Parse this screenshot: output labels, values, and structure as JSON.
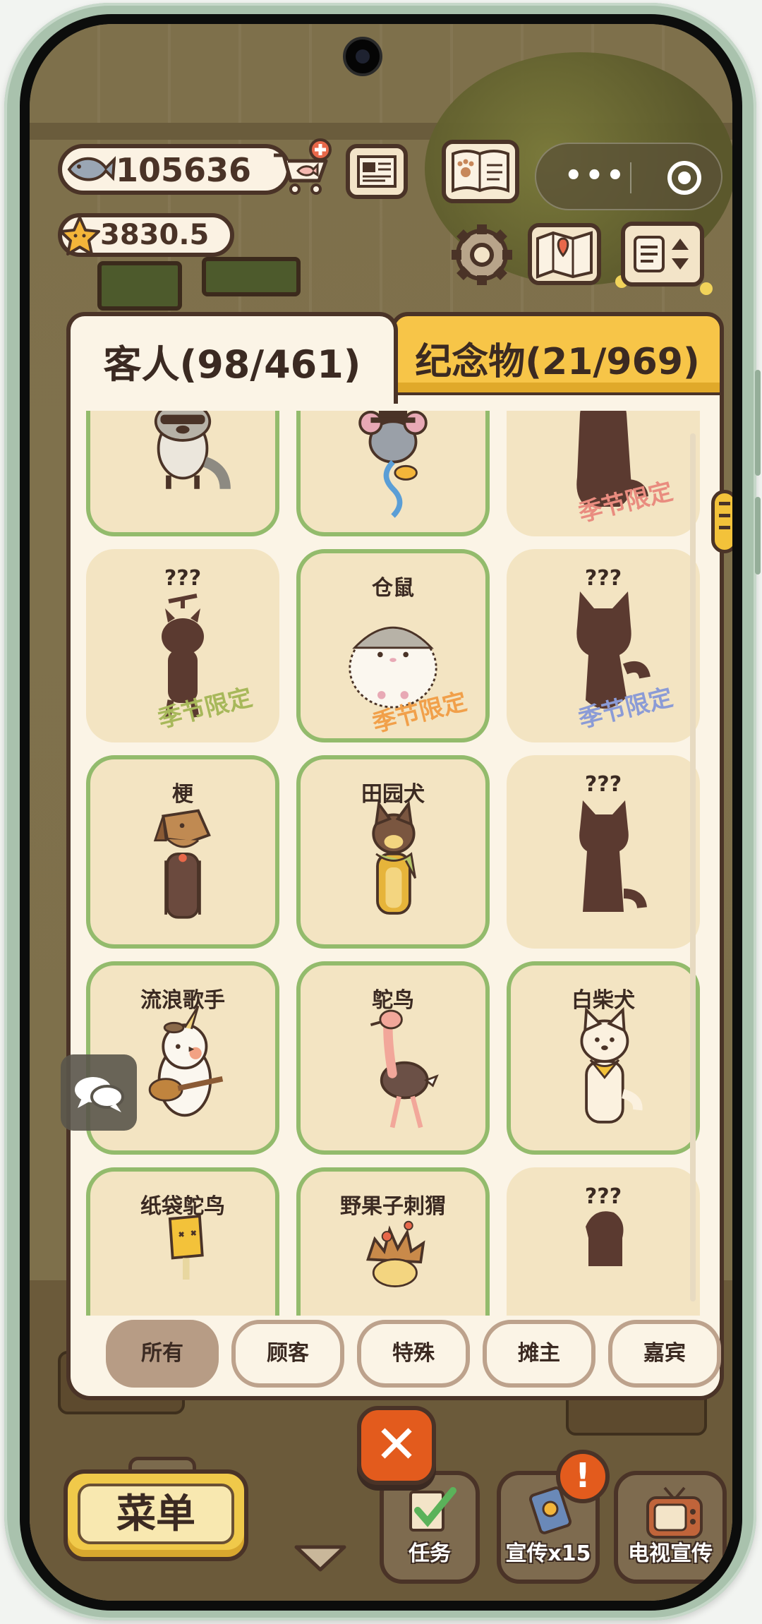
{
  "hud": {
    "fish_count": "105636",
    "star_count": "3830.5"
  },
  "tabs": [
    {
      "label": "客人(98/461)",
      "active": true
    },
    {
      "label": "纪念物(21/969)",
      "active": false
    }
  ],
  "limited_label": "季节限定",
  "guests": [
    {
      "name": "",
      "owned": true,
      "limited": false,
      "silhouette": false,
      "figure": "raccoon"
    },
    {
      "name": "",
      "owned": true,
      "limited": false,
      "silhouette": false,
      "figure": "mouse-hat"
    },
    {
      "name": "",
      "owned": false,
      "limited": true,
      "limited_color": "#e98c7f",
      "silhouette": true,
      "figure": "silhouette-fluffy"
    },
    {
      "name": "???",
      "owned": false,
      "limited": true,
      "limited_color": "#a7b85a",
      "silhouette": true,
      "figure": "silhouette-propeller"
    },
    {
      "name": "仓鼠",
      "owned": true,
      "limited": true,
      "limited_color": "#f1a04a",
      "silhouette": false,
      "figure": "hamster"
    },
    {
      "name": "???",
      "owned": false,
      "limited": true,
      "limited_color": "#8b9bd6",
      "silhouette": true,
      "figure": "silhouette-cat"
    },
    {
      "name": "梗",
      "owned": true,
      "limited": false,
      "silhouette": false,
      "figure": "terrier"
    },
    {
      "name": "田园犬",
      "owned": true,
      "limited": false,
      "silhouette": false,
      "figure": "field-dog"
    },
    {
      "name": "???",
      "owned": false,
      "limited": false,
      "silhouette": true,
      "figure": "silhouette-dog"
    },
    {
      "name": "流浪歌手",
      "owned": true,
      "limited": false,
      "silhouette": false,
      "figure": "cockatiel-guitar"
    },
    {
      "name": "鸵鸟",
      "owned": true,
      "limited": false,
      "silhouette": false,
      "figure": "ostrich"
    },
    {
      "name": "白柴犬",
      "owned": true,
      "limited": false,
      "silhouette": false,
      "figure": "white-shiba"
    },
    {
      "name": "纸袋鸵鸟",
      "owned": true,
      "limited": false,
      "silhouette": false,
      "figure": "paperbag-ostrich"
    },
    {
      "name": "野果子刺猬",
      "owned": true,
      "limited": false,
      "silhouette": false,
      "figure": "hedgehog"
    },
    {
      "name": "???",
      "owned": false,
      "limited": false,
      "silhouette": true,
      "figure": "silhouette-small"
    }
  ],
  "filters": [
    {
      "label": "所有",
      "active": true
    },
    {
      "label": "顾客",
      "active": false
    },
    {
      "label": "特殊",
      "active": false
    },
    {
      "label": "摊主",
      "active": false
    },
    {
      "label": "嘉宾",
      "active": false
    }
  ],
  "bottom": {
    "menu_label": "菜单",
    "task_label": "任务",
    "promo_label": "宣传x15",
    "tv_label": "电视宣传",
    "alert_mark": "!"
  }
}
